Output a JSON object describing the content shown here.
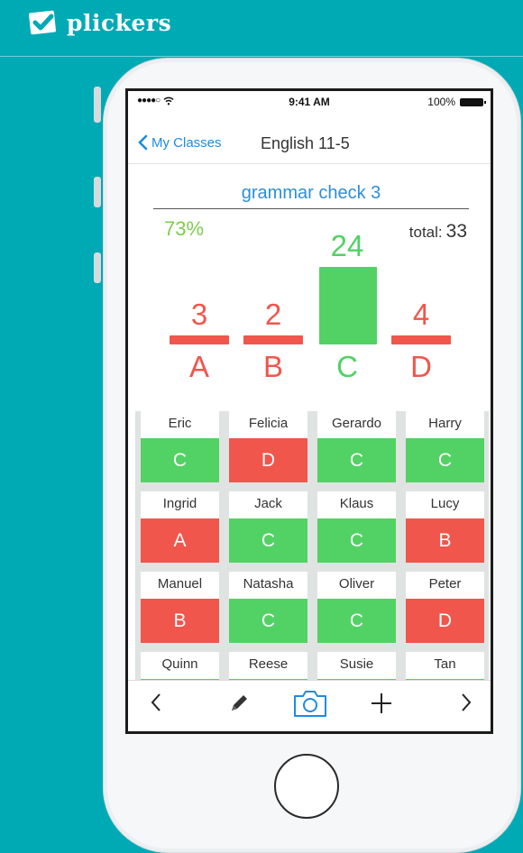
{
  "brand": {
    "name": "plickers"
  },
  "status_bar": {
    "time": "9:41 AM",
    "battery": "100%"
  },
  "nav": {
    "back_label": "My Classes",
    "title": "English 11-5"
  },
  "poll": {
    "question": "grammar check 3",
    "percent_correct": "73%",
    "total_label": "total:",
    "total_value": "33"
  },
  "colors": {
    "correct": "#52d264",
    "incorrect": "#f0564c",
    "accent": "#1e8be0",
    "brand": "#00aab5"
  },
  "chart_data": {
    "type": "bar",
    "categories": [
      "A",
      "B",
      "C",
      "D"
    ],
    "values": [
      3,
      2,
      24,
      4
    ],
    "correct": "C",
    "title": "",
    "xlabel": "",
    "ylabel": ""
  },
  "students": [
    {
      "name": "Eric",
      "answer": "C",
      "correct": true
    },
    {
      "name": "Felicia",
      "answer": "D",
      "correct": false
    },
    {
      "name": "Gerardo",
      "answer": "C",
      "correct": true
    },
    {
      "name": "Harry",
      "answer": "C",
      "correct": true
    },
    {
      "name": "Ingrid",
      "answer": "A",
      "correct": false
    },
    {
      "name": "Jack",
      "answer": "C",
      "correct": true
    },
    {
      "name": "Klaus",
      "answer": "C",
      "correct": true
    },
    {
      "name": "Lucy",
      "answer": "B",
      "correct": false
    },
    {
      "name": "Manuel",
      "answer": "B",
      "correct": false
    },
    {
      "name": "Natasha",
      "answer": "C",
      "correct": true
    },
    {
      "name": "Oliver",
      "answer": "C",
      "correct": true
    },
    {
      "name": "Peter",
      "answer": "D",
      "correct": false
    },
    {
      "name": "Quinn",
      "answer": "",
      "correct": true
    },
    {
      "name": "Reese",
      "answer": "",
      "correct": true
    },
    {
      "name": "Susie",
      "answer": "",
      "correct": true
    },
    {
      "name": "Tan",
      "answer": "",
      "correct": true
    }
  ],
  "toolbar": {
    "icons": [
      "chevron-left-icon",
      "pencil-icon",
      "camera-icon",
      "plus-icon",
      "chevron-right-icon"
    ]
  }
}
